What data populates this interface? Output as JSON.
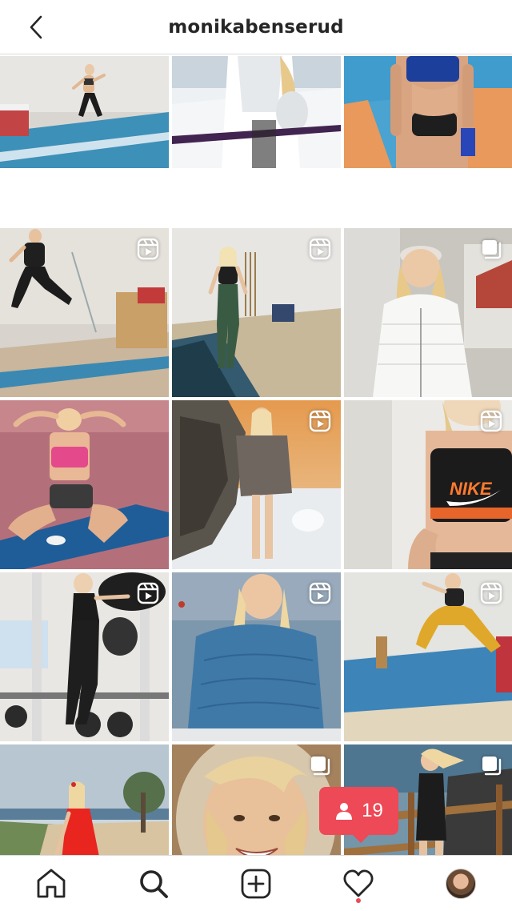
{
  "header": {
    "title": "monikabenserud",
    "back_icon": "chevron-left-icon"
  },
  "grid": {
    "tiles": [
      {
        "name": "post-1",
        "badge": "none"
      },
      {
        "name": "post-2",
        "badge": "none"
      },
      {
        "name": "post-3",
        "badge": "none"
      },
      {
        "name": "post-4",
        "badge": "reels-icon"
      },
      {
        "name": "post-5",
        "badge": "reels-icon"
      },
      {
        "name": "post-6",
        "badge": "carousel-icon"
      },
      {
        "name": "post-7",
        "badge": "none"
      },
      {
        "name": "post-8",
        "badge": "reels-icon"
      },
      {
        "name": "post-9",
        "badge": "reels-icon"
      },
      {
        "name": "post-10",
        "badge": "reels-icon"
      },
      {
        "name": "post-11",
        "badge": "reels-icon"
      },
      {
        "name": "post-12",
        "badge": "reels-icon"
      },
      {
        "name": "post-13",
        "badge": "none"
      },
      {
        "name": "post-14",
        "badge": "carousel-icon"
      },
      {
        "name": "post-15",
        "badge": "carousel-icon"
      }
    ],
    "photo_texts": {
      "nike": "NIKE"
    }
  },
  "notification": {
    "icon": "person-icon",
    "count": "19",
    "color": "#ed4956"
  },
  "tabbar": {
    "items": [
      {
        "name": "home-icon"
      },
      {
        "name": "search-icon",
        "active": true
      },
      {
        "name": "new-post-icon"
      },
      {
        "name": "activity-heart-icon",
        "has_dot": true
      },
      {
        "name": "profile-avatar"
      }
    ]
  }
}
